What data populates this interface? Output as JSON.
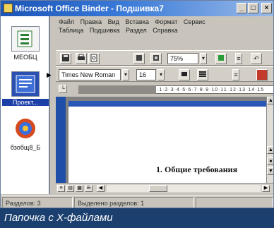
{
  "window": {
    "title": "Microsoft Office Binder - Подшивка7",
    "minimize": "_",
    "maximize": "□",
    "close": "×"
  },
  "menu": {
    "row1": [
      "Файл",
      "Правка",
      "Вид",
      "Вставка",
      "Формат",
      "Сервис"
    ],
    "row2": [
      "Таблица",
      "Подшивка",
      "Раздел",
      "Справка"
    ]
  },
  "binder": {
    "sections": [
      {
        "label": "МЕОБЦ",
        "icon": "excel-sheet-icon"
      },
      {
        "label": "Проект...",
        "icon": "word-document-icon",
        "selected": true
      },
      {
        "label": "бзобщ8_Б",
        "icon": "presentation-icon"
      }
    ]
  },
  "toolbar": {
    "zoom": "75%",
    "font": "Times New Roman",
    "size": "16"
  },
  "document": {
    "heading": "1. Общие требования"
  },
  "status": {
    "section": "Разделов: 3",
    "selected": "Выделено разделов: 1"
  },
  "caption": "Папочка с X-файлами",
  "colors": {
    "title_bar": "#1b55b7",
    "caption_bg": "#1b3f6e",
    "selection": "#1c3fa8"
  }
}
